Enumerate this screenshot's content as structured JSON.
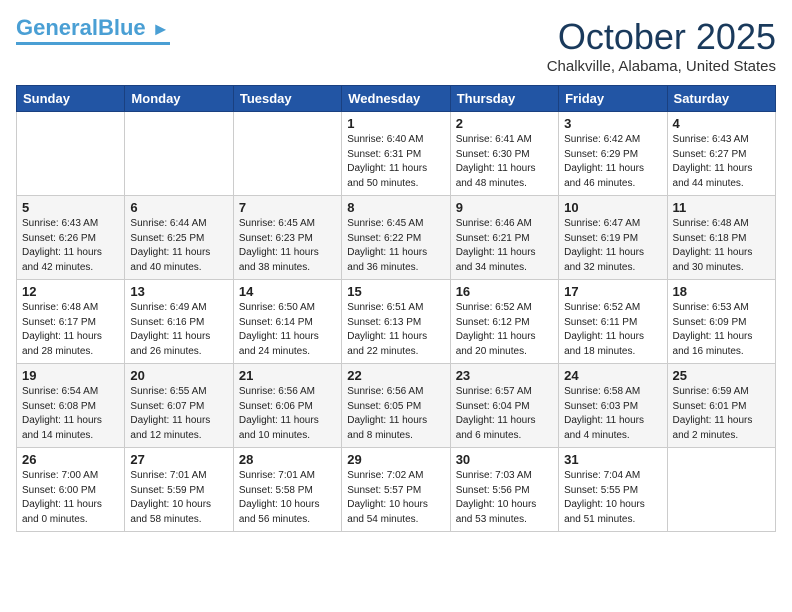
{
  "header": {
    "logo_general": "General",
    "logo_blue": "Blue",
    "month": "October 2025",
    "location": "Chalkville, Alabama, United States"
  },
  "weekdays": [
    "Sunday",
    "Monday",
    "Tuesday",
    "Wednesday",
    "Thursday",
    "Friday",
    "Saturday"
  ],
  "weeks": [
    [
      {
        "day": "",
        "sunrise": "",
        "sunset": "",
        "daylight": ""
      },
      {
        "day": "",
        "sunrise": "",
        "sunset": "",
        "daylight": ""
      },
      {
        "day": "",
        "sunrise": "",
        "sunset": "",
        "daylight": ""
      },
      {
        "day": "1",
        "sunrise": "Sunrise: 6:40 AM",
        "sunset": "Sunset: 6:31 PM",
        "daylight": "Daylight: 11 hours and 50 minutes."
      },
      {
        "day": "2",
        "sunrise": "Sunrise: 6:41 AM",
        "sunset": "Sunset: 6:30 PM",
        "daylight": "Daylight: 11 hours and 48 minutes."
      },
      {
        "day": "3",
        "sunrise": "Sunrise: 6:42 AM",
        "sunset": "Sunset: 6:29 PM",
        "daylight": "Daylight: 11 hours and 46 minutes."
      },
      {
        "day": "4",
        "sunrise": "Sunrise: 6:43 AM",
        "sunset": "Sunset: 6:27 PM",
        "daylight": "Daylight: 11 hours and 44 minutes."
      }
    ],
    [
      {
        "day": "5",
        "sunrise": "Sunrise: 6:43 AM",
        "sunset": "Sunset: 6:26 PM",
        "daylight": "Daylight: 11 hours and 42 minutes."
      },
      {
        "day": "6",
        "sunrise": "Sunrise: 6:44 AM",
        "sunset": "Sunset: 6:25 PM",
        "daylight": "Daylight: 11 hours and 40 minutes."
      },
      {
        "day": "7",
        "sunrise": "Sunrise: 6:45 AM",
        "sunset": "Sunset: 6:23 PM",
        "daylight": "Daylight: 11 hours and 38 minutes."
      },
      {
        "day": "8",
        "sunrise": "Sunrise: 6:45 AM",
        "sunset": "Sunset: 6:22 PM",
        "daylight": "Daylight: 11 hours and 36 minutes."
      },
      {
        "day": "9",
        "sunrise": "Sunrise: 6:46 AM",
        "sunset": "Sunset: 6:21 PM",
        "daylight": "Daylight: 11 hours and 34 minutes."
      },
      {
        "day": "10",
        "sunrise": "Sunrise: 6:47 AM",
        "sunset": "Sunset: 6:19 PM",
        "daylight": "Daylight: 11 hours and 32 minutes."
      },
      {
        "day": "11",
        "sunrise": "Sunrise: 6:48 AM",
        "sunset": "Sunset: 6:18 PM",
        "daylight": "Daylight: 11 hours and 30 minutes."
      }
    ],
    [
      {
        "day": "12",
        "sunrise": "Sunrise: 6:48 AM",
        "sunset": "Sunset: 6:17 PM",
        "daylight": "Daylight: 11 hours and 28 minutes."
      },
      {
        "day": "13",
        "sunrise": "Sunrise: 6:49 AM",
        "sunset": "Sunset: 6:16 PM",
        "daylight": "Daylight: 11 hours and 26 minutes."
      },
      {
        "day": "14",
        "sunrise": "Sunrise: 6:50 AM",
        "sunset": "Sunset: 6:14 PM",
        "daylight": "Daylight: 11 hours and 24 minutes."
      },
      {
        "day": "15",
        "sunrise": "Sunrise: 6:51 AM",
        "sunset": "Sunset: 6:13 PM",
        "daylight": "Daylight: 11 hours and 22 minutes."
      },
      {
        "day": "16",
        "sunrise": "Sunrise: 6:52 AM",
        "sunset": "Sunset: 6:12 PM",
        "daylight": "Daylight: 11 hours and 20 minutes."
      },
      {
        "day": "17",
        "sunrise": "Sunrise: 6:52 AM",
        "sunset": "Sunset: 6:11 PM",
        "daylight": "Daylight: 11 hours and 18 minutes."
      },
      {
        "day": "18",
        "sunrise": "Sunrise: 6:53 AM",
        "sunset": "Sunset: 6:09 PM",
        "daylight": "Daylight: 11 hours and 16 minutes."
      }
    ],
    [
      {
        "day": "19",
        "sunrise": "Sunrise: 6:54 AM",
        "sunset": "Sunset: 6:08 PM",
        "daylight": "Daylight: 11 hours and 14 minutes."
      },
      {
        "day": "20",
        "sunrise": "Sunrise: 6:55 AM",
        "sunset": "Sunset: 6:07 PM",
        "daylight": "Daylight: 11 hours and 12 minutes."
      },
      {
        "day": "21",
        "sunrise": "Sunrise: 6:56 AM",
        "sunset": "Sunset: 6:06 PM",
        "daylight": "Daylight: 11 hours and 10 minutes."
      },
      {
        "day": "22",
        "sunrise": "Sunrise: 6:56 AM",
        "sunset": "Sunset: 6:05 PM",
        "daylight": "Daylight: 11 hours and 8 minutes."
      },
      {
        "day": "23",
        "sunrise": "Sunrise: 6:57 AM",
        "sunset": "Sunset: 6:04 PM",
        "daylight": "Daylight: 11 hours and 6 minutes."
      },
      {
        "day": "24",
        "sunrise": "Sunrise: 6:58 AM",
        "sunset": "Sunset: 6:03 PM",
        "daylight": "Daylight: 11 hours and 4 minutes."
      },
      {
        "day": "25",
        "sunrise": "Sunrise: 6:59 AM",
        "sunset": "Sunset: 6:01 PM",
        "daylight": "Daylight: 11 hours and 2 minutes."
      }
    ],
    [
      {
        "day": "26",
        "sunrise": "Sunrise: 7:00 AM",
        "sunset": "Sunset: 6:00 PM",
        "daylight": "Daylight: 11 hours and 0 minutes."
      },
      {
        "day": "27",
        "sunrise": "Sunrise: 7:01 AM",
        "sunset": "Sunset: 5:59 PM",
        "daylight": "Daylight: 10 hours and 58 minutes."
      },
      {
        "day": "28",
        "sunrise": "Sunrise: 7:01 AM",
        "sunset": "Sunset: 5:58 PM",
        "daylight": "Daylight: 10 hours and 56 minutes."
      },
      {
        "day": "29",
        "sunrise": "Sunrise: 7:02 AM",
        "sunset": "Sunset: 5:57 PM",
        "daylight": "Daylight: 10 hours and 54 minutes."
      },
      {
        "day": "30",
        "sunrise": "Sunrise: 7:03 AM",
        "sunset": "Sunset: 5:56 PM",
        "daylight": "Daylight: 10 hours and 53 minutes."
      },
      {
        "day": "31",
        "sunrise": "Sunrise: 7:04 AM",
        "sunset": "Sunset: 5:55 PM",
        "daylight": "Daylight: 10 hours and 51 minutes."
      },
      {
        "day": "",
        "sunrise": "",
        "sunset": "",
        "daylight": ""
      }
    ]
  ]
}
